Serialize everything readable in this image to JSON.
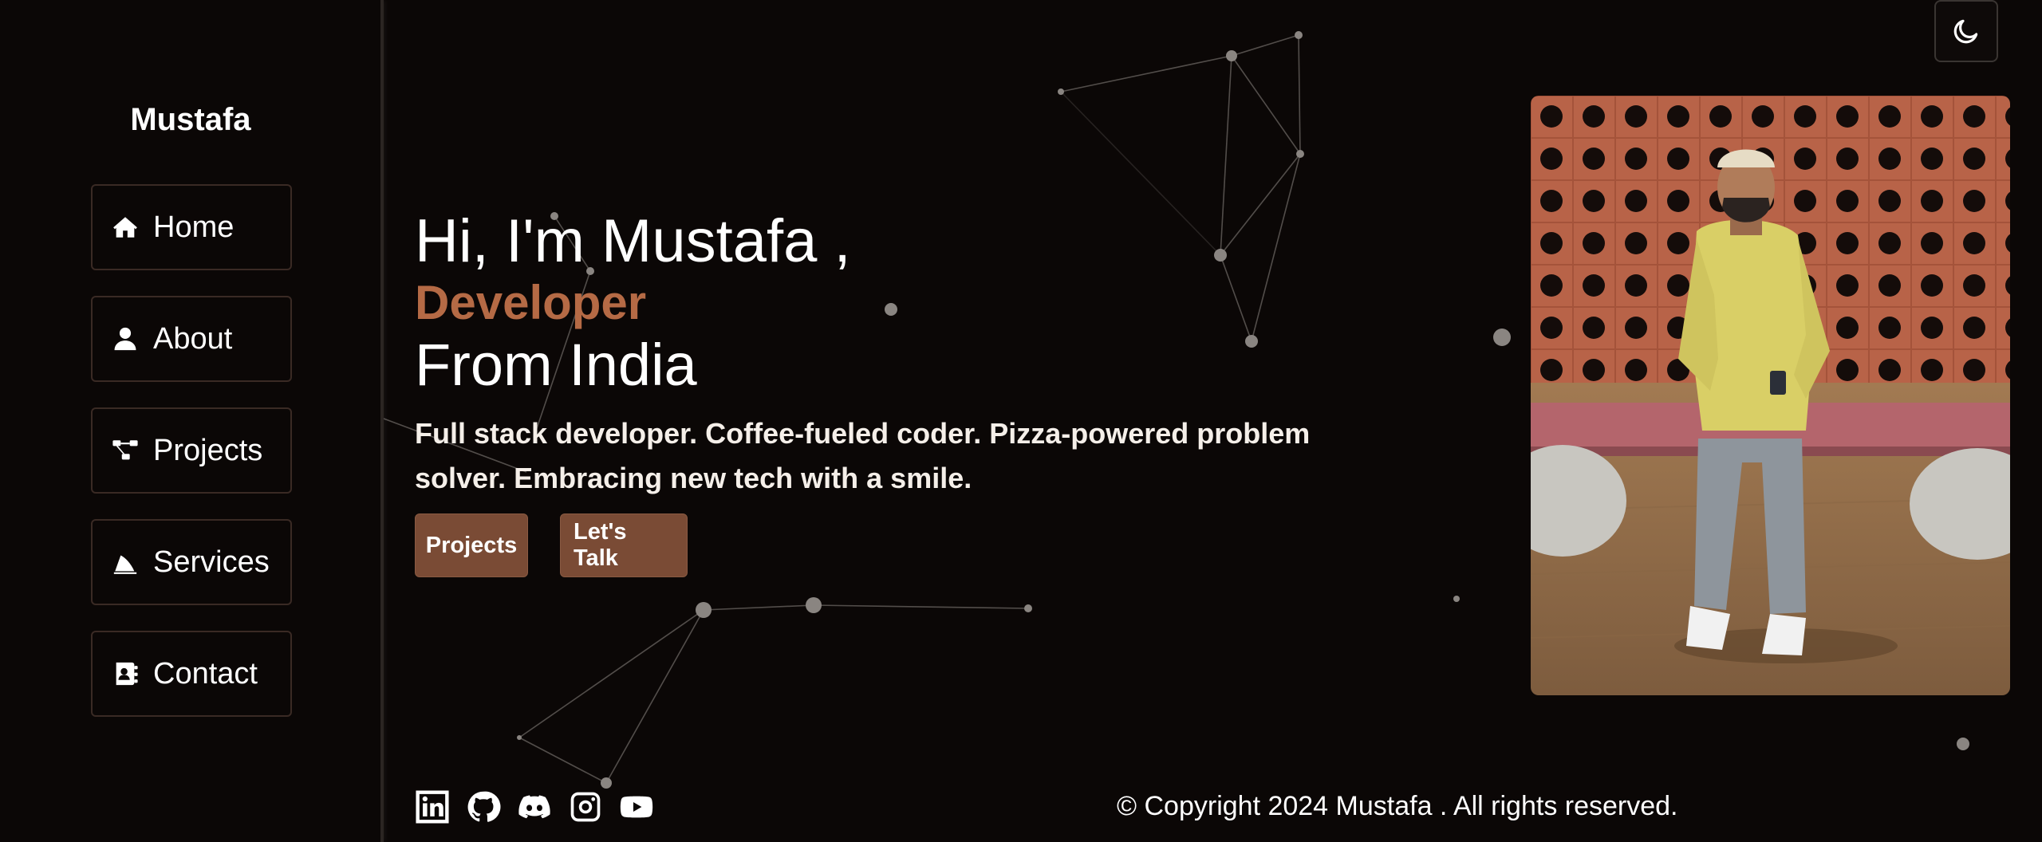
{
  "sidebar": {
    "brand": "Mustafa",
    "items": [
      {
        "label": "Home",
        "icon": "home-icon"
      },
      {
        "label": "About",
        "icon": "user-icon"
      },
      {
        "label": "Projects",
        "icon": "project-diagram-icon"
      },
      {
        "label": "Services",
        "icon": "services-icon"
      },
      {
        "label": "Contact",
        "icon": "address-book-icon"
      }
    ]
  },
  "hero": {
    "greeting": "Hi, I'm Mustafa ,",
    "role": "Developer",
    "origin": "From India",
    "description": "Full stack developer. Coffee-fueled coder. Pizza-powered problem solver. Embracing new tech with a smile.",
    "buttons": {
      "projects": "Projects",
      "talk": "Let's Talk"
    }
  },
  "theme_toggle": {
    "icon": "moon-icon"
  },
  "socials": [
    {
      "name": "linkedin",
      "icon": "linkedin-icon"
    },
    {
      "name": "github",
      "icon": "github-icon"
    },
    {
      "name": "discord",
      "icon": "discord-icon"
    },
    {
      "name": "instagram",
      "icon": "instagram-icon"
    },
    {
      "name": "youtube",
      "icon": "youtube-icon"
    }
  ],
  "footer": {
    "copyright": "© Copyright 2024 Mustafa . All rights reserved."
  },
  "colors": {
    "background": "#0b0706",
    "accent": "#b56a45",
    "button": "#7a4b35",
    "text": "#ffffff"
  }
}
